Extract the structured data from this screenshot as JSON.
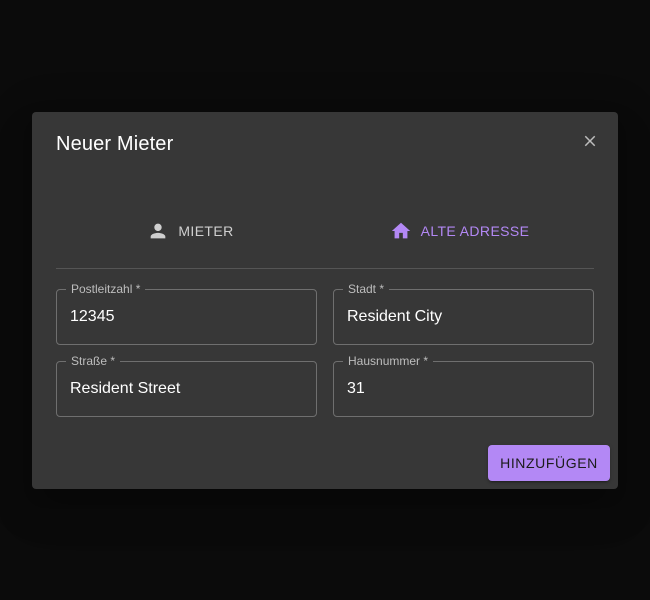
{
  "dialog": {
    "title": "Neuer Mieter",
    "close_icon": "close-icon"
  },
  "tabs": [
    {
      "label": "MIETER",
      "icon": "person-icon",
      "active": false,
      "color": "#cfcfcf"
    },
    {
      "label": "ALTE ADRESSE",
      "icon": "home-icon",
      "active": true,
      "color": "#b388f5"
    }
  ],
  "form": {
    "postleitzahl": {
      "label": "Postleitzahl *",
      "value": "12345"
    },
    "stadt": {
      "label": "Stadt *",
      "value": "Resident City"
    },
    "strasse": {
      "label": "Straße *",
      "value": "Resident Street"
    },
    "hausnummer": {
      "label": "Hausnummer *",
      "value": "31"
    }
  },
  "actions": {
    "submit_label": "HINZUFÜGEN"
  },
  "colors": {
    "accent": "#b388f5",
    "surface": "#373737",
    "backdrop": "#0b0b0b"
  }
}
